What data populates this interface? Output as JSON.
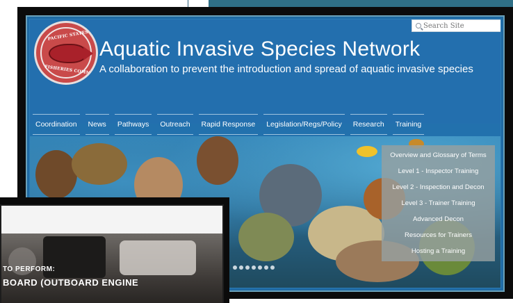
{
  "logo": {
    "top_text": "PACIFIC STATES MARINE",
    "bottom_text": "FISHERIES COMMISSION"
  },
  "search": {
    "placeholder": "Search Site"
  },
  "header": {
    "title": "Aquatic Invasive Species Network",
    "subtitle": "A collaboration to prevent the introduction and spread of aquatic invasive species"
  },
  "nav": {
    "items": [
      "Coordination",
      "News",
      "Pathways",
      "Outreach",
      "Rapid Response",
      "Legislation/Regs/Policy",
      "Research",
      "Training"
    ]
  },
  "dropdown": {
    "items": [
      "Overview and Glossary of Terms",
      "Level 1 - Inspector Training",
      "Level 2 - Inspection and Decon",
      "Level 3 - Trainer Training",
      "Advanced Decon",
      "Resources for Trainers",
      "Hosting a Training"
    ]
  },
  "second_screenshot": {
    "line1": "TO PERFORM:",
    "line2": "BOARD (OUTBOARD ENGINE"
  },
  "colors": {
    "header_blue": "#236fae",
    "dropdown_bg": "#96a0a0",
    "top_strip": "#2f6f86"
  }
}
